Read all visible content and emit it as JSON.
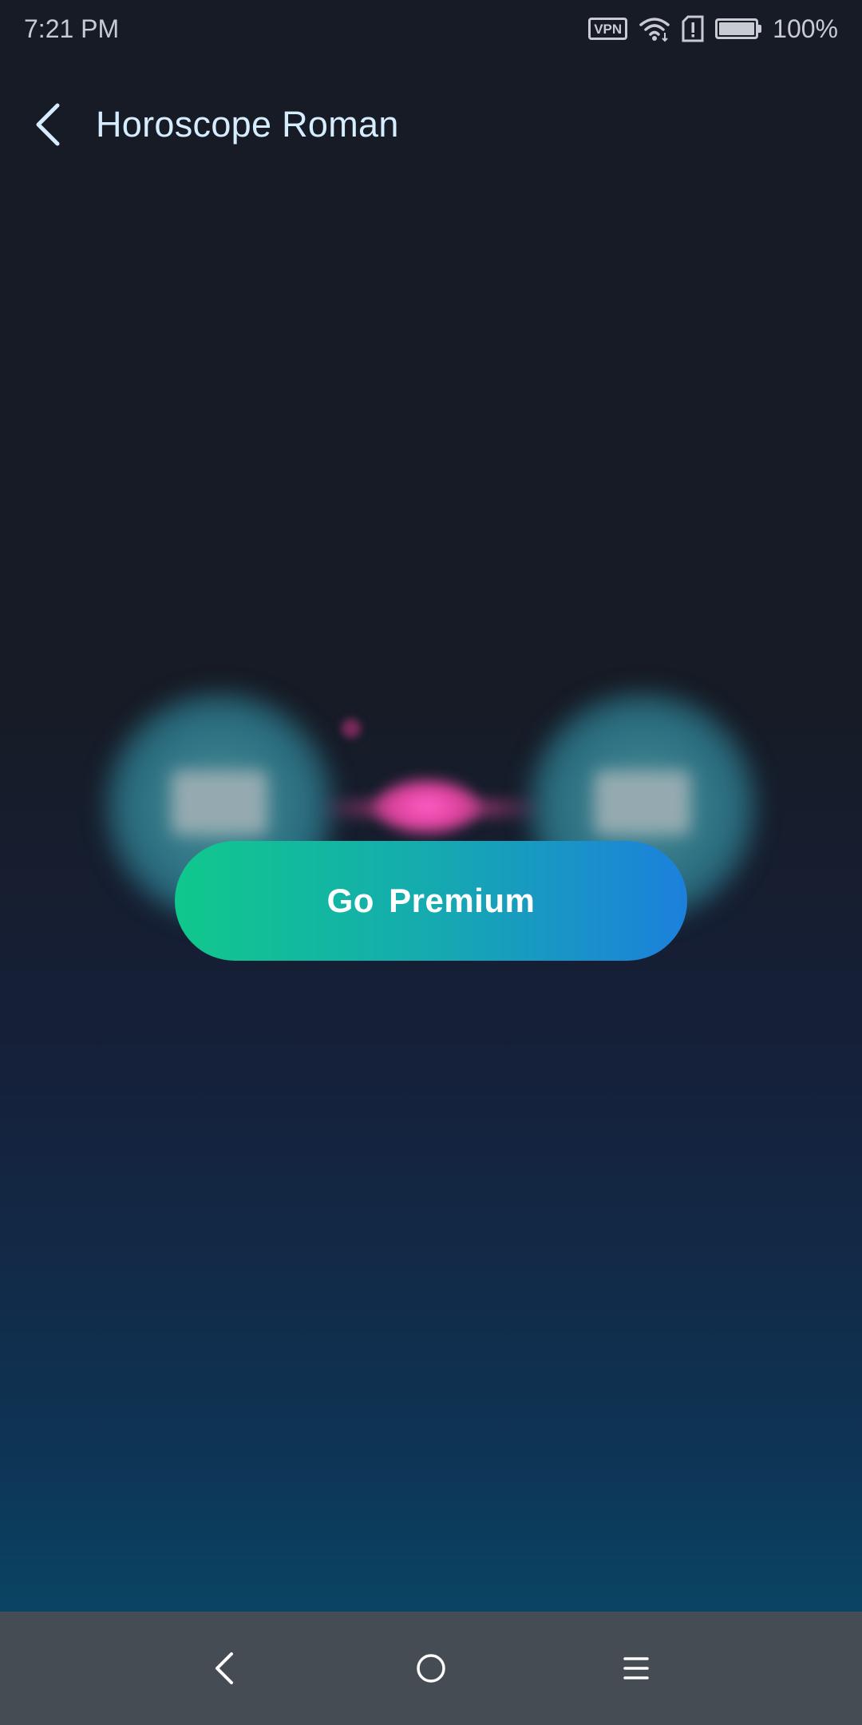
{
  "status_bar": {
    "time": "7:21 PM",
    "vpn_label": "VPN",
    "battery_percent": "100%",
    "icons": [
      "vpn-icon",
      "wifi-icon",
      "sim-alert-icon",
      "battery-icon"
    ]
  },
  "header": {
    "title": "Horoscope Roman",
    "back_icon": "chevron-left-icon"
  },
  "main": {
    "premium_button_label": "Go  Premium"
  },
  "nav_bar": {
    "icons": [
      "back-triangle-icon",
      "home-circle-icon",
      "menu-lines-icon"
    ]
  },
  "colors": {
    "background_top": "#161b25",
    "background_bottom": "#06506f",
    "button_gradient_start": "#10c88c",
    "button_gradient_end": "#1c80dc",
    "title_text": "#d6ecff",
    "nav_bar": "#464c54"
  }
}
